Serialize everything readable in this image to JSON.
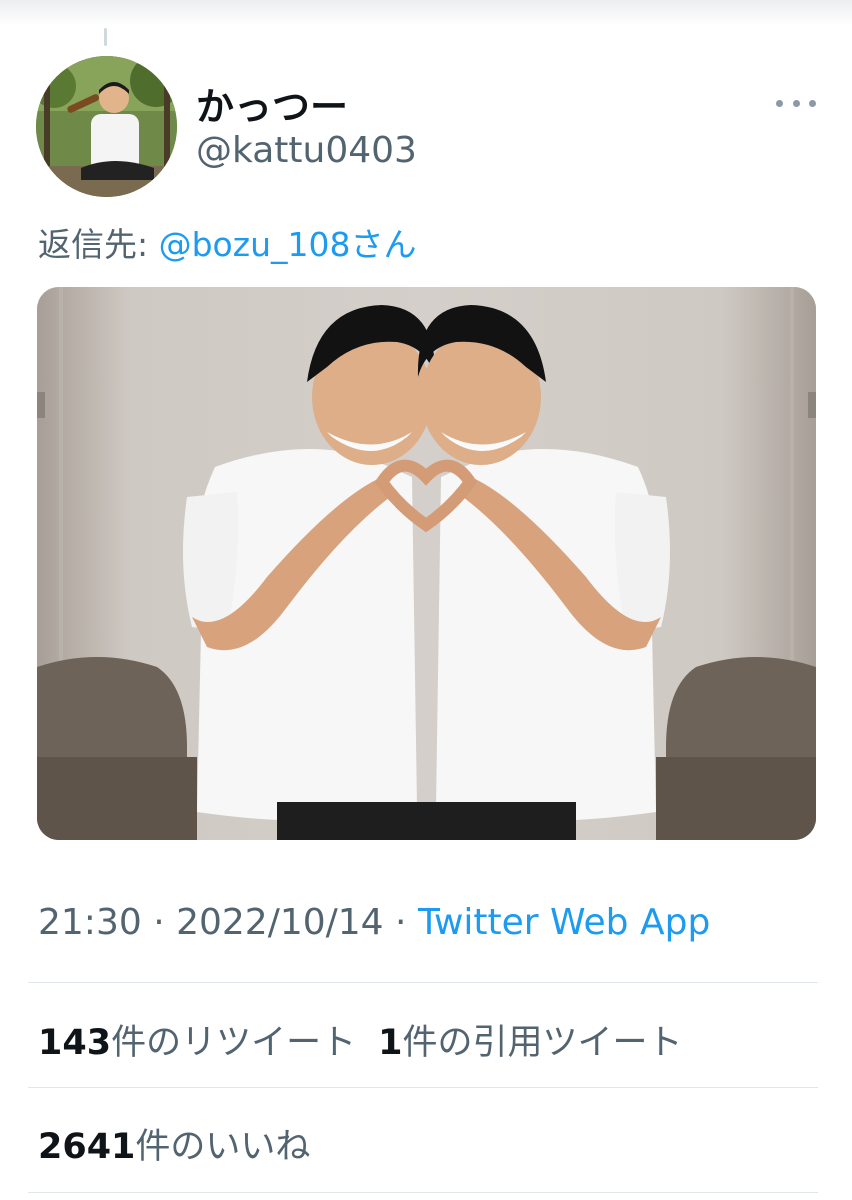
{
  "tweet": {
    "display_name": "かっつー",
    "handle": "@kattu0403",
    "reply_prefix": "返信先: ",
    "reply_mention": "@bozu_108さん",
    "time": "21:30",
    "date": "2022/10/14",
    "source": "Twitter Web App",
    "separator": " · "
  },
  "stats": {
    "retweet_count": "143",
    "retweet_label": "件のリツイート",
    "quote_count": "1",
    "quote_label": "件の引用ツイート",
    "like_count": "2641",
    "like_label": "件のいいね"
  },
  "icons": {
    "more": "more-horizontal-icon"
  },
  "colors": {
    "link": "#1d9bf0",
    "secondary_text": "#536471",
    "primary_text": "#0f1419"
  }
}
